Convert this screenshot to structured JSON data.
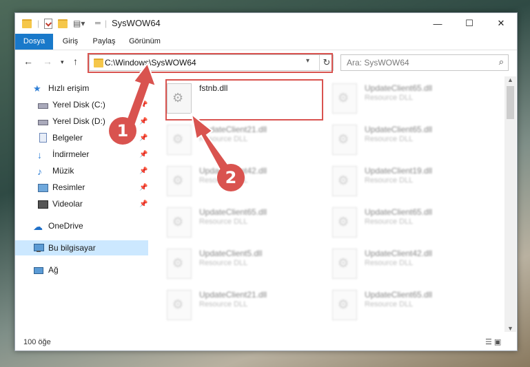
{
  "window": {
    "title": "SysWOW64",
    "controls": [
      "—",
      "☐",
      "✕"
    ]
  },
  "ribbon": {
    "tabs": [
      {
        "label": "Dosya",
        "active": true
      },
      {
        "label": "Giriş",
        "active": false
      },
      {
        "label": "Paylaş",
        "active": false
      },
      {
        "label": "Görünüm",
        "active": false
      }
    ]
  },
  "address": {
    "path": "C:\\Windows\\SysWOW64"
  },
  "search": {
    "placeholder": "Ara: SysWOW64"
  },
  "sidebar": {
    "items": [
      {
        "label": "Hızlı erişim",
        "icon": "star-icon",
        "pinned": false,
        "selected": false
      },
      {
        "label": "Yerel Disk (C:)",
        "icon": "drive-icon",
        "pinned": true,
        "selected": false
      },
      {
        "label": "Yerel Disk (D:)",
        "icon": "drive-icon",
        "pinned": true,
        "selected": false
      },
      {
        "label": "Belgeler",
        "icon": "document-icon",
        "pinned": true,
        "selected": false
      },
      {
        "label": "İndirmeler",
        "icon": "download-icon",
        "pinned": true,
        "selected": false
      },
      {
        "label": "Müzik",
        "icon": "music-icon",
        "pinned": true,
        "selected": false
      },
      {
        "label": "Resimler",
        "icon": "picture-icon",
        "pinned": true,
        "selected": false
      },
      {
        "label": "Videolar",
        "icon": "video-icon",
        "pinned": true,
        "selected": false
      },
      {
        "label": "OneDrive",
        "icon": "cloud-icon",
        "pinned": false,
        "selected": false
      },
      {
        "label": "Bu bilgisayar",
        "icon": "computer-icon",
        "pinned": false,
        "selected": true
      },
      {
        "label": "Ağ",
        "icon": "network-icon",
        "pinned": false,
        "selected": false
      }
    ]
  },
  "files": {
    "left": [
      {
        "name": "fstnb.dll",
        "type": ""
      },
      {
        "name": "UpdateClient21.dll",
        "type": "Resource DLL"
      },
      {
        "name": "UpdateClient42.dll",
        "type": "Resource DLL"
      },
      {
        "name": "UpdateClient65.dll",
        "type": "Resource DLL"
      },
      {
        "name": "UpdateClient5.dll",
        "type": "Resource DLL"
      },
      {
        "name": "UpdateClient21.dll",
        "type": "Resource DLL"
      }
    ],
    "right": [
      {
        "name": "UpdateClient65.dll",
        "type": "Resource DLL"
      },
      {
        "name": "UpdateClient65.dll",
        "type": "Resource DLL"
      },
      {
        "name": "UpdateClient19.dll",
        "type": "Resource DLL"
      },
      {
        "name": "UpdateClient65.dll",
        "type": "Resource DLL"
      },
      {
        "name": "UpdateClient42.dll",
        "type": "Resource DLL"
      },
      {
        "name": "UpdateClient65.dll",
        "type": "Resource DLL"
      }
    ]
  },
  "status": {
    "count": "100 öğe"
  },
  "annotations": {
    "step1": "1",
    "step2": "2",
    "color": "#d9534f"
  }
}
